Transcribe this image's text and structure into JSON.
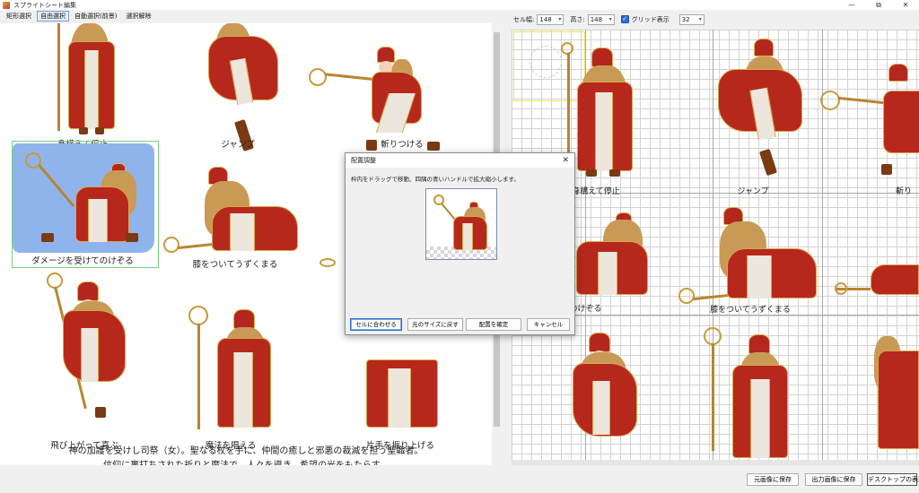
{
  "window": {
    "title": "スプライトシート編集",
    "controls": [
      "—",
      "⧉",
      "✕"
    ]
  },
  "left_toolbar": {
    "buttons": [
      "矩形選択",
      "自由選択",
      "自動選択(前景)",
      "選択解除"
    ],
    "active_index": 1
  },
  "left_sprites": {
    "labels": [
      "身構えて停止",
      "ジャンプ",
      "斬りつける",
      "ダメージを受けてのけぞる",
      "膝をついてうずくまる",
      "飛び上がって喜ぶ",
      "魔法を唱える",
      "片手を振り上げる"
    ],
    "description_line1": "神の加護を受けし司祭（女）。聖なる杖を手に、仲間の癒しと邪悪の裁滅を担う聖職者。",
    "description_line2": "信仰に裏打ちされた祈りと魔法で、人々を導き、希望の光をもたらす。"
  },
  "right_toolbar": {
    "cell_width_label": "セル幅:",
    "cell_width_value": "148",
    "height_label": "高さ:",
    "height_value": "148",
    "grid_label": "グリッド表示",
    "grid_checked": true,
    "zoom_value": "32"
  },
  "right_sprites": {
    "labels": [
      "身構えて停止",
      "ジャンプ",
      "斬り",
      "ジを受けてのけぞる",
      "膝をついてうずくまる"
    ]
  },
  "dialog": {
    "title": "配置調整",
    "close": "✕",
    "message": "枠内をドラッグで移動、四隅の青いハンドルで拡大縮小します。",
    "buttons": [
      "セルに合わせる",
      "元のサイズに戻す",
      "配置を確定",
      "キャンセル"
    ]
  },
  "bottom_bar": {
    "buttons": [
      "元画像に保存",
      "出力画像に保存",
      "デスクトップの表示"
    ]
  },
  "colors": {
    "accent": "#2b6cd1",
    "robe_red": "#b7281c",
    "gold": "#d9a84a",
    "selection_fill": "#8fb4ec",
    "cell_highlight": "#f2e44a"
  }
}
